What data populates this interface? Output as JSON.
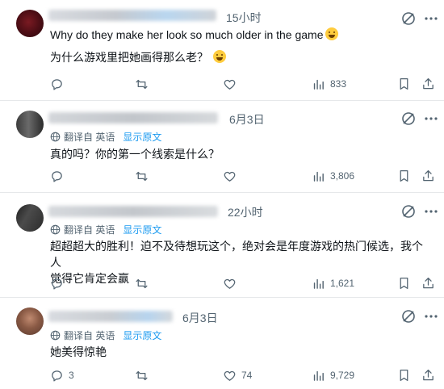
{
  "colors": {
    "accent": "#1d9bf0",
    "secondary_text": "#536471",
    "primary_text": "#0f1419",
    "divider": "#e6e8ea"
  },
  "tweets": [
    {
      "time": "15小时",
      "lines": [
        "Why do they make her look so much older in the game",
        "为什么游戏里把她画得那么老？"
      ],
      "replies": "",
      "retweets": "",
      "likes": "",
      "views": "833"
    },
    {
      "time": "6月3日",
      "translate": {
        "label": "翻译自 英语",
        "show": "显示原文"
      },
      "lines": [
        "真的吗？你的第一个线索是什么？"
      ],
      "replies": "",
      "retweets": "",
      "likes": "",
      "views": "3,806"
    },
    {
      "time": "22小时",
      "translate": {
        "label": "翻译自 英语",
        "show": "显示原文"
      },
      "lines": [
        "超超超大的胜利！迫不及待想玩这个，绝对会是年度游戏的热门候选，我个人",
        "觉得它肯定会赢"
      ],
      "replies": "",
      "retweets": "",
      "likes": "",
      "views": "1,621"
    },
    {
      "time": "6月3日",
      "translate": {
        "label": "翻译自 英语",
        "show": "显示原文"
      },
      "lines": [
        "她美得惊艳"
      ],
      "replies": "3",
      "retweets": "",
      "likes": "74",
      "views": "9,729"
    }
  ],
  "icons": {
    "reply": "reply-icon",
    "retweet": "retweet-icon",
    "like": "heart-icon",
    "views": "views-bar-icon",
    "bookmark": "bookmark-icon",
    "share": "share-icon",
    "grok": "grok-icon",
    "translate": "globe-icon"
  }
}
